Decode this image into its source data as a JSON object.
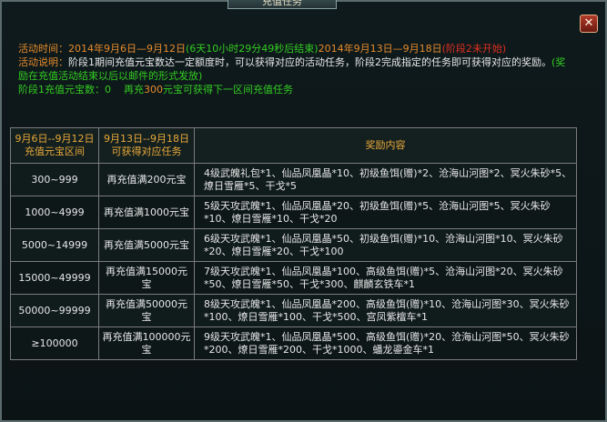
{
  "window": {
    "title": "充值任务"
  },
  "info": {
    "time_label": "活动时间：",
    "time_phase1": "2014年9月6日—9月12日",
    "countdown": "(6天10小时29分49秒后结束)",
    "time_phase2": "2014年9月13日—9月18日",
    "not_started": "(阶段2未开始)",
    "desc_label": "活动说明：",
    "desc_text": "阶段1期间充值元宝数达一定额度时，可以获得对应的活动任务，阶段2完成指定的任务即可获得对应的奖励。",
    "mail_note": "(奖励在充值活动结束以后以邮件的形式发放)",
    "recharge_label": "阶段1充值元宝数：",
    "recharge_value": "0",
    "next_prefix": "再充",
    "next_amount": "300",
    "next_suffix": "元宝可获得下一区间充值任务"
  },
  "table": {
    "headers": {
      "col1_line1": "9月6日--9月12日",
      "col1_line2": "充值元宝区间",
      "col2_line1": "9月13日--9月18日",
      "col2_line2": "可获得对应任务",
      "col3": "奖励内容"
    },
    "rows": [
      {
        "range": "300~999",
        "task": "再充值满200元宝",
        "rewards": "4级武魄礼包*1、仙品凤凰晶*10、初级鱼饵(赠)*2、沧海山河图*2、冥火朱砂*5、燎日雪雁*5、干戈*5"
      },
      {
        "range": "1000~4999",
        "task": "再充值满1000元宝",
        "rewards": "5级天攻武魄*1、仙品凤凰晶*20、初级鱼饵(赠)*5、沧海山河图*5、冥火朱砂*10、燎日雪雁*10、干戈*20"
      },
      {
        "range": "5000~14999",
        "task": "再充值满5000元宝",
        "rewards": "6级天攻武魄*1、仙品凤凰晶*50、初级鱼饵(赠)*10、沧海山河图*10、冥火朱砂*20、燎日雪雁*20、干戈*100"
      },
      {
        "range": "15000~49999",
        "task": "再充值满15000元宝",
        "rewards": "7级天攻武魄*1、仙品凤凰晶*100、高级鱼饵(赠)*5、沧海山河图*20、冥火朱砂*50、燎日雪雁*50、干戈*300、麒麟玄铁车*1"
      },
      {
        "range": "50000~99999",
        "task": "再充值满50000元宝",
        "rewards": "8级天攻武魄*1、仙品凤凰晶*200、高级鱼饵(赠)*10、沧海山河图*30、冥火朱砂*100、燎日雪雁*100、干戈*500、宫凤紫檀车*1"
      },
      {
        "range": "≥100000",
        "task": "再充值满100000元宝",
        "rewards": "9级天攻武魄*1、仙品凤凰晶*500、高级鱼饵(赠)*20、沧海山河图*50、冥火朱砂*200、燎日雪雁*200、干戈*1000、蟠龙鎏金车*1"
      }
    ]
  }
}
